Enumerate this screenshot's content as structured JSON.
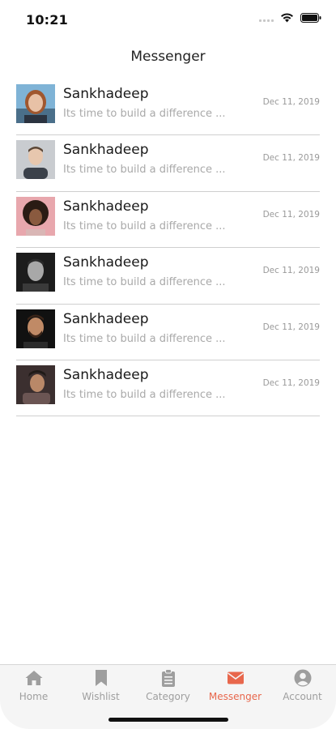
{
  "status": {
    "time": "10:21"
  },
  "header": {
    "title": "Messenger"
  },
  "conversations": [
    {
      "name": "Sankhadeep",
      "preview": "Its time to build a difference ...",
      "date": "Dec 11, 2019",
      "avatar": "avatar-woman-icon"
    },
    {
      "name": "Sankhadeep",
      "preview": "Its time to build a difference ...",
      "date": "Dec 11, 2019",
      "avatar": "avatar-man-icon"
    },
    {
      "name": "Sankhadeep",
      "preview": "Its time to build a difference ...",
      "date": "Dec 11, 2019",
      "avatar": "avatar-woman-curly-icon"
    },
    {
      "name": "Sankhadeep",
      "preview": "Its time to build a difference ...",
      "date": "Dec 11, 2019",
      "avatar": "avatar-man-bw-icon"
    },
    {
      "name": "Sankhadeep",
      "preview": "Its time to build a difference ...",
      "date": "Dec 11, 2019",
      "avatar": "avatar-man-beard-icon"
    },
    {
      "name": "Sankhadeep",
      "preview": "Its time to build a difference ...",
      "date": "Dec 11, 2019",
      "avatar": "avatar-man-hat-icon"
    }
  ],
  "tabbar": {
    "tabs": [
      {
        "label": "Home",
        "icon": "home-icon",
        "active": false
      },
      {
        "label": "Wishlist",
        "icon": "bookmark-icon",
        "active": false
      },
      {
        "label": "Category",
        "icon": "clipboard-icon",
        "active": false
      },
      {
        "label": "Messenger",
        "icon": "envelope-icon",
        "active": true
      },
      {
        "label": "Account",
        "icon": "user-circle-icon",
        "active": false
      }
    ]
  },
  "colors": {
    "accent": "#e8674c",
    "inactive": "#9e9e9e",
    "divider": "#cfcfcf"
  }
}
